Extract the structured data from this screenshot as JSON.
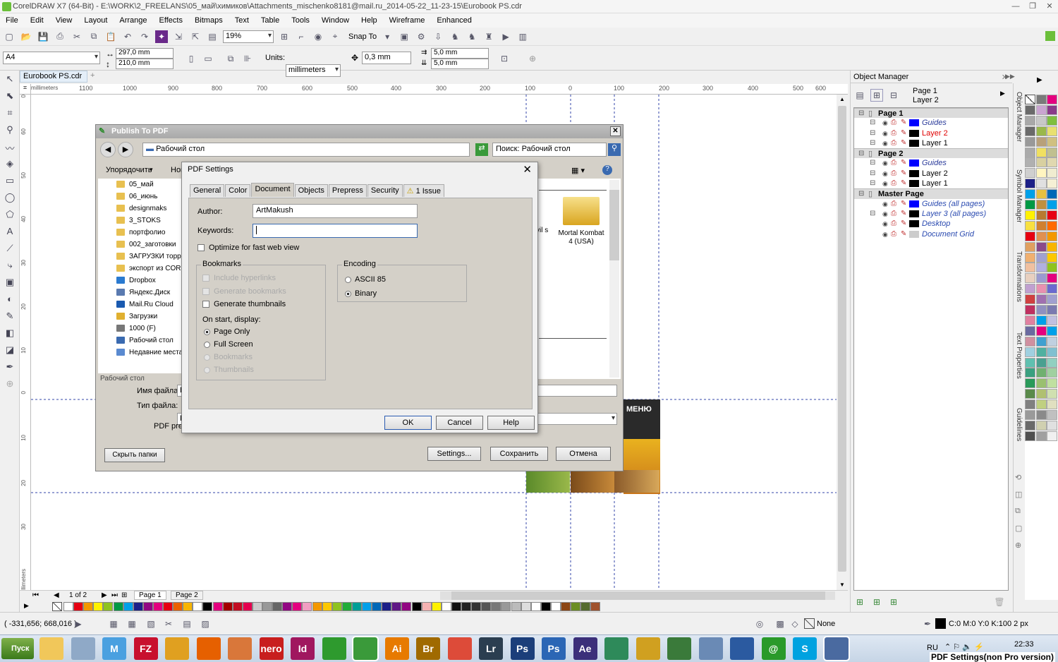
{
  "window": {
    "title": "CorelDRAW X7 (64-Bit) - E:\\WORK\\2_FREELANS\\05_май\\химиков\\Attachments_mischenko8181@mail.ru_2014-05-22_11-23-15\\Eurobook PS.cdr"
  },
  "menu": [
    "File",
    "Edit",
    "View",
    "Layout",
    "Arrange",
    "Effects",
    "Bitmaps",
    "Text",
    "Table",
    "Tools",
    "Window",
    "Help",
    "Wireframe",
    "Enhanced"
  ],
  "toolbar": {
    "zoom": "19%",
    "snap_label": "Snap To"
  },
  "propbar": {
    "paper": "A4",
    "width": "297,0 mm",
    "height": "210,0 mm",
    "units_label": "Units:",
    "units": "millimeters",
    "nudge": "0,3 mm",
    "dup_x": "5,0 mm",
    "dup_y": "5,0 mm"
  },
  "doc_tab": "Eurobook PS.cdr",
  "ruler_h": [
    "1100",
    "1000",
    "900",
    "800",
    "700",
    "600",
    "500",
    "400",
    "300",
    "200",
    "100",
    "0",
    "100",
    "200",
    "300",
    "400",
    "500",
    "600",
    "millimeters"
  ],
  "ruler_v": [
    "0",
    "60",
    "50",
    "40",
    "30",
    "20",
    "10",
    "0",
    "10",
    "20",
    "30",
    "millimeters"
  ],
  "page_nav": {
    "count": "1 of 2",
    "pages": [
      "Page 1",
      "Page 2"
    ]
  },
  "status": {
    "coords": "( -331,656; 668,016 )",
    "fill": "None",
    "outline": "C:0 M:0 Y:0 K:100  2 px"
  },
  "publish": {
    "title": "Publish To PDF",
    "location": "Рабочий стол",
    "search": "Поиск: Рабочий стол",
    "organize": "Упорядочить",
    "new": "Нов",
    "folders": [
      "05_май",
      "06_июнь",
      "designmaks",
      "3_STOKS",
      "портфолио",
      "002_заготовки",
      "ЗАГРУЗКИ торре",
      "экспорт из CORE",
      "Dropbox",
      "Яндекс.Диск",
      "Mail.Ru Cloud",
      "Загрузки",
      "1000 (F)",
      "Рабочий стол",
      "Недавние места"
    ],
    "file_item": "Mortal Kombat 4 (USA)",
    "file_item_partial": "vil s )",
    "filename_label": "Имя файла:",
    "filetype_label": "Тип файла:",
    "preset_label": "PDF pres",
    "hide_folders": "Скрыть папки",
    "settings": "Settings...",
    "save": "Сохранить",
    "cancel": "Отмена",
    "fn_val": "E",
    "ft_val": "P",
    "other_partial": "Рабочий стол"
  },
  "pdf_settings": {
    "title": "PDF Settings",
    "tabs": [
      "General",
      "Color",
      "Document",
      "Objects",
      "Prepress",
      "Security",
      "1 Issue"
    ],
    "author_label": "Author:",
    "author": "ArtMakush",
    "keywords_label": "Keywords:",
    "optimize": "Optimize for fast web view",
    "bookmarks": {
      "title": "Bookmarks",
      "include": "Include hyperlinks",
      "generate": "Generate bookmarks",
      "thumbs": "Generate thumbnails",
      "onstart": "On start, display:",
      "opts": [
        "Page Only",
        "Full Screen",
        "Bookmarks",
        "Thumbnails"
      ]
    },
    "encoding": {
      "title": "Encoding",
      "opts": [
        "ASCII 85",
        "Binary"
      ]
    },
    "ok": "OK",
    "cancel": "Cancel",
    "help": "Help"
  },
  "object_manager": {
    "title": "Object Manager",
    "current_page": "Page 1",
    "current_layer": "Layer 2",
    "tree": [
      {
        "label": "Page 1",
        "level": 0,
        "type": "page"
      },
      {
        "label": "Guides",
        "level": 1,
        "type": "layer",
        "color": "#0000ff",
        "style": "italic"
      },
      {
        "label": "Layer 2",
        "level": 1,
        "type": "layer",
        "color": "#000000",
        "style": "active"
      },
      {
        "label": "Layer 1",
        "level": 1,
        "type": "layer",
        "color": "#000000",
        "style": ""
      },
      {
        "label": "Page 2",
        "level": 0,
        "type": "page"
      },
      {
        "label": "Guides",
        "level": 1,
        "type": "layer",
        "color": "#0000ff",
        "style": "italic"
      },
      {
        "label": "Layer 2",
        "level": 1,
        "type": "layer",
        "color": "#000000",
        "style": ""
      },
      {
        "label": "Layer 1",
        "level": 1,
        "type": "layer",
        "color": "#000000",
        "style": ""
      },
      {
        "label": "Master Page",
        "level": 0,
        "type": "page"
      },
      {
        "label": "Guides (all pages)",
        "level": 1,
        "type": "layer",
        "color": "#0000ff",
        "style": "master"
      },
      {
        "label": "Layer 3 (all pages)",
        "level": 1,
        "type": "layer",
        "color": "#000000",
        "style": "master"
      },
      {
        "label": "Desktop",
        "level": 1,
        "type": "layer",
        "color": "#000000",
        "style": "master"
      },
      {
        "label": "Document Grid",
        "level": 1,
        "type": "layer",
        "color": "#cccccc",
        "style": "master"
      }
    ]
  },
  "dock_tabs": [
    "Object Manager",
    "Symbol Manager",
    "Transformations",
    "Text Properties",
    "Guidelines"
  ],
  "canvas_menu": "МЕНЮ",
  "taskbar": {
    "start": "Пуск",
    "lang": "RU",
    "time": "22:33",
    "pinned": [
      {
        "icon": "folder-icon",
        "label": "",
        "color": "#f1c75a"
      },
      {
        "icon": "notepad-icon",
        "label": "",
        "color": "#8fa9c7"
      },
      {
        "icon": "m-icon",
        "label": "M",
        "color": "#4aa0e0"
      },
      {
        "icon": "filezilla-icon",
        "label": "FZ",
        "color": "#c8102e"
      },
      {
        "icon": "pen-icon",
        "label": "",
        "color": "#e0a020"
      },
      {
        "icon": "firefox-icon",
        "label": "",
        "color": "#e66000"
      },
      {
        "icon": "brush-icon",
        "label": "",
        "color": "#d9773a"
      },
      {
        "icon": "nero-icon",
        "label": "nero",
        "color": "#c81e1e"
      },
      {
        "icon": "indesign-icon",
        "label": "Id",
        "color": "#a0175f"
      },
      {
        "icon": "leaf-icon",
        "label": "",
        "color": "#2e9a2e"
      },
      {
        "icon": "coreldraw-icon",
        "label": "",
        "color": "#3a9a3a"
      },
      {
        "icon": "illustrator-icon",
        "label": "Ai",
        "color": "#e77a00"
      },
      {
        "icon": "bridge-icon",
        "label": "Br",
        "color": "#a06a00"
      },
      {
        "icon": "chrome-icon",
        "label": "",
        "color": "#dd4b39"
      },
      {
        "icon": "lightroom-icon",
        "label": "Lr",
        "color": "#2b3e50"
      },
      {
        "icon": "photoshop-icon",
        "label": "Ps",
        "color": "#1b3e7a"
      },
      {
        "icon": "photoshop2-icon",
        "label": "Ps",
        "color": "#2b66b5"
      },
      {
        "icon": "aftereffects-icon",
        "label": "Ae",
        "color": "#3b2f7a"
      },
      {
        "icon": "ms-icon",
        "label": "",
        "color": "#2e8a5a"
      },
      {
        "icon": "tag-icon",
        "label": "",
        "color": "#d0a020"
      },
      {
        "icon": "flash-icon",
        "label": "",
        "color": "#3a7a3a"
      },
      {
        "icon": "gear-icon",
        "label": "",
        "color": "#6a8ab5"
      },
      {
        "icon": "monitor-icon",
        "label": "",
        "color": "#2b5aa0"
      },
      {
        "icon": "icq-icon",
        "label": "@",
        "color": "#2a9a2a"
      },
      {
        "icon": "skype-icon",
        "label": "S",
        "color": "#00a2e0"
      },
      {
        "icon": "corel-active-icon",
        "label": "",
        "color": "#4a6aa0"
      }
    ]
  },
  "bottom_overlay": "PDF Settings(non Pro version)",
  "colors": {
    "palette": [
      "#ffffff",
      "#000000",
      "#ff0000",
      "#ffff00",
      "#00a0e9",
      "#e60012",
      "#f39800",
      "#8fc31f",
      "#00a0e9",
      "#e5004f",
      "#009944",
      "#fff100",
      "#1d2088",
      "#920783",
      "#c30d23",
      "#ffd700",
      "#6a3906",
      "#0068b7",
      "#ff8c00",
      "#808080",
      "#c0c0c0",
      "#f5b2b2",
      "#9acd32",
      "#4b0082"
    ]
  }
}
